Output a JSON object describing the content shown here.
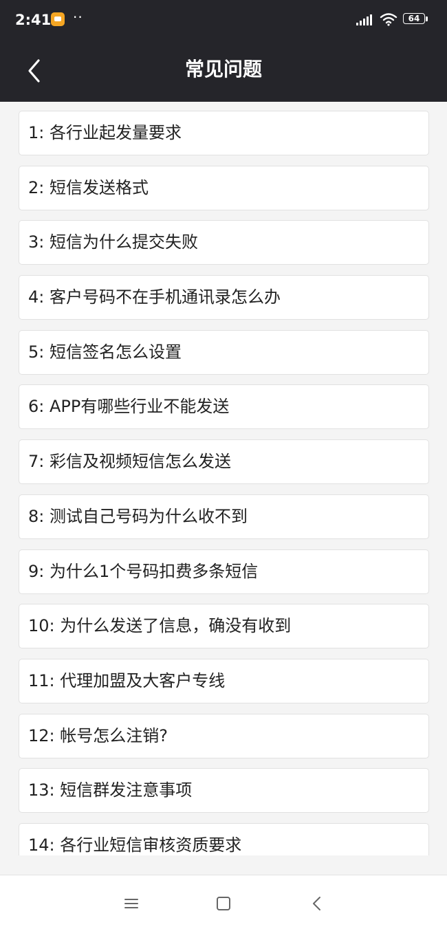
{
  "status_bar": {
    "time": "2:41",
    "dots": "··",
    "battery_level": "64"
  },
  "header": {
    "title": "常见问题"
  },
  "faq": {
    "items": [
      "1: 各行业起发量要求",
      "2: 短信发送格式",
      "3: 短信为什么提交失败",
      "4: 客户号码不在手机通讯录怎么办",
      "5: 短信签名怎么设置",
      "6: APP有哪些行业不能发送",
      "7: 彩信及视频短信怎么发送",
      "8: 测试自己号码为什么收不到",
      "9: 为什么1个号码扣费多条短信",
      "10: 为什么发送了信息，确没有收到",
      "11: 代理加盟及大客户专线",
      "12:  帐号怎么注销?",
      "13: 短信群发注意事项",
      "14: 各行业短信审核资质要求"
    ]
  },
  "icons": {
    "notification": "notification-icon",
    "signal": "signal-icon",
    "wifi": "wifi-icon",
    "battery": "battery-icon",
    "back": "chevron-left-icon",
    "system_menu": "menu-icon",
    "system_home": "square-icon",
    "system_back": "chevron-left-icon"
  },
  "colors": {
    "header_background": "#25252a",
    "page_background": "#f4f4f4",
    "card_background": "#ffffff",
    "card_border": "#e1e1e1",
    "text": "#222222",
    "notification_accent": "#f5a623"
  }
}
